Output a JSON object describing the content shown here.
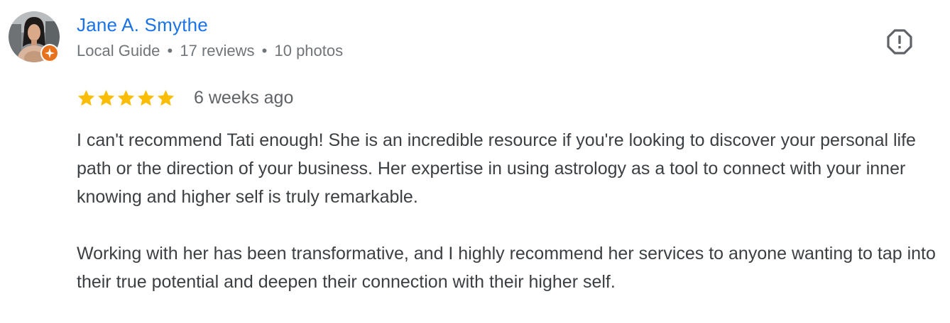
{
  "reviewer": {
    "name": "Jane A. Smythe",
    "level": "Local Guide",
    "separator": "•",
    "reviews": "17 reviews",
    "photos": "10 photos"
  },
  "rating": {
    "stars": 5,
    "max": 5,
    "time_ago": "6 weeks ago",
    "star_color": "#fbbc04"
  },
  "review": {
    "paragraphs": [
      "I can't recommend Tati enough! She is an incredible resource if you're looking to discover your personal life path or the direction of your business. Her expertise in using astrology as a tool to connect with your inner knowing and higher self is truly remarkable.",
      "Working with her has been transformative, and I highly recommend her services to anyone wanting to tap into their true potential and deepen their connection with their higher self."
    ]
  },
  "icons": {
    "avatar": "avatar",
    "badge": "local-guide-badge-icon",
    "report": "report-icon",
    "star": "star-icon"
  },
  "colors": {
    "name": "#1a73e8",
    "badge": "#e8711c",
    "meta": "#70757a",
    "text": "#3c4043"
  }
}
